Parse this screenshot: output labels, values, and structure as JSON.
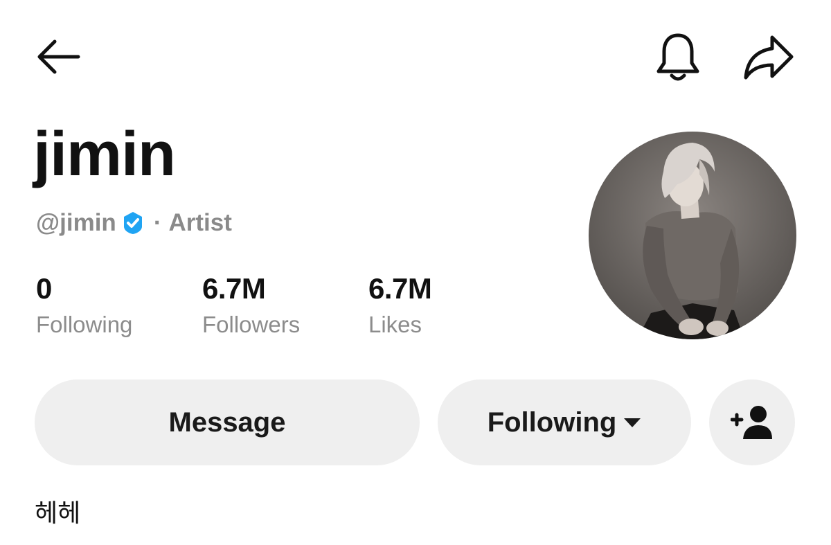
{
  "header": {
    "back_icon": "arrow-left-icon",
    "bell_icon": "bell-icon",
    "share_icon": "share-arrow-icon"
  },
  "profile": {
    "display_name": "jimin",
    "handle": "@jimin",
    "separator": "·",
    "category": "Artist",
    "verified_color": "#20a4f3",
    "avatar": "profile-photo"
  },
  "stats": [
    {
      "value": "0",
      "label": "Following"
    },
    {
      "value": "6.7M",
      "label": "Followers"
    },
    {
      "value": "6.7M",
      "label": "Likes"
    }
  ],
  "actions": {
    "message_label": "Message",
    "following_label": "Following",
    "add_friend_icon": "add-user-icon"
  },
  "bio": "헤헤",
  "colors": {
    "button_bg": "#efefef",
    "muted_text": "#8a8a8a",
    "text": "#111111"
  }
}
